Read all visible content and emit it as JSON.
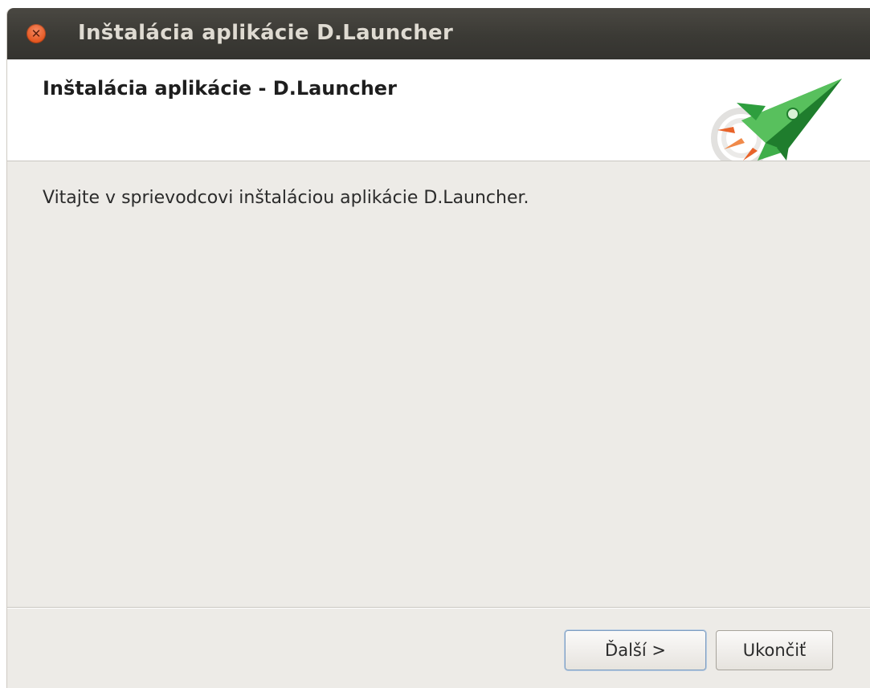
{
  "window": {
    "title": "Inštalácia aplikácie D.Launcher",
    "close_glyph": "✕"
  },
  "header": {
    "title": "Inštalácia aplikácie - D.Launcher",
    "logo_icon": "rocket-icon"
  },
  "body": {
    "welcome": "Vitajte v sprievodcovi inštaláciou aplikácie D.Launcher."
  },
  "footer": {
    "next_label": "Ďalší >",
    "quit_label": "Ukončiť"
  },
  "colors": {
    "titlebar": "#3b3a35",
    "close_button": "#e4561f",
    "dialog_bg": "#edebe7",
    "rocket_green": "#2e9e3e",
    "flame": "#e8632a"
  }
}
